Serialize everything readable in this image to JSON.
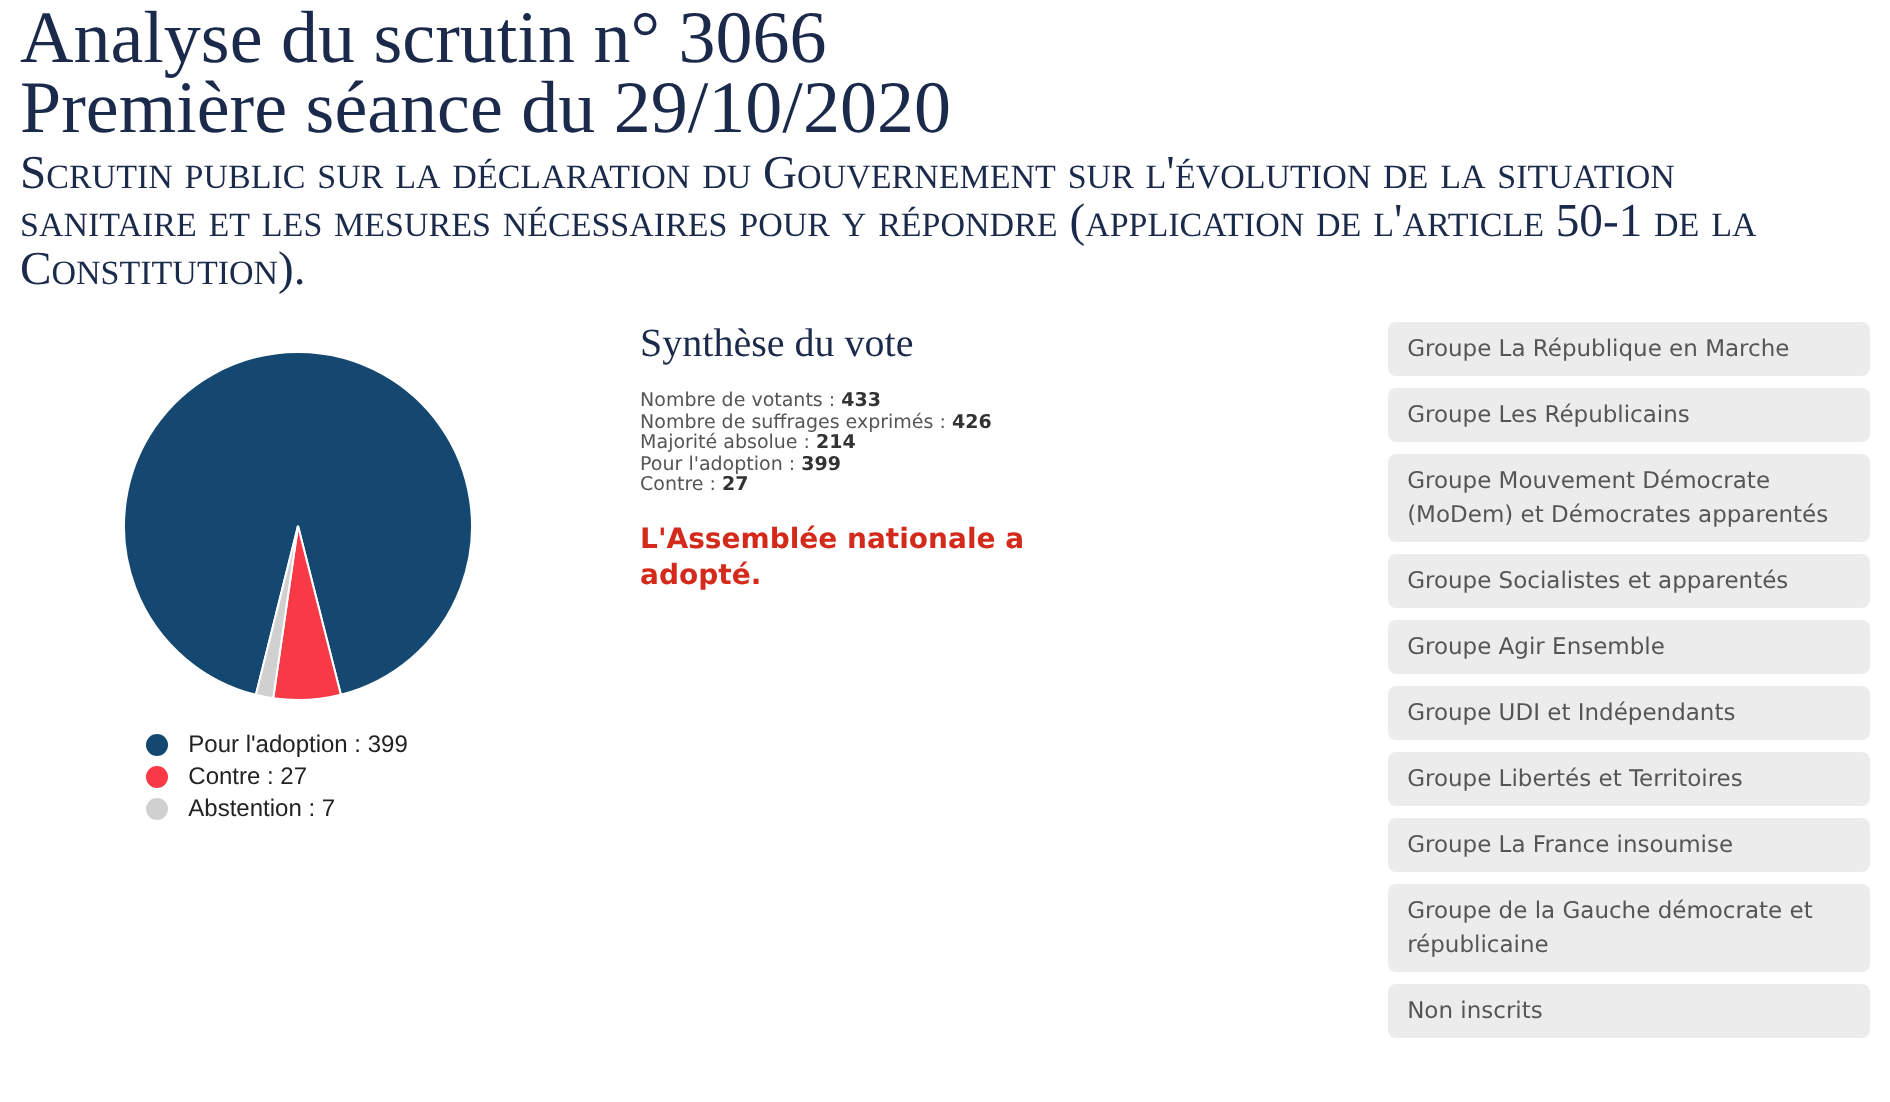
{
  "title": "Analyse du scrutin n° 3066",
  "session": "Première séance du 29/10/2020",
  "subject": "Scrutin public sur la déclaration du Gouvernement sur l'évolution de la situation sanitaire et les mesures nécessaires pour y répondre (application de l'article 50-1 de la Constitution).",
  "chart": {
    "chart_data": {
      "type": "pie",
      "categories": [
        "Pour l'adoption : 399",
        "Contre : 27",
        "Abstention : 7"
      ],
      "values": [
        399,
        27,
        7
      ]
    },
    "legend": [
      {
        "color": "#144870"
      },
      {
        "color": "#f73a46"
      },
      {
        "color": "#d0d0d0"
      }
    ]
  },
  "summary": {
    "heading": "Synthèse du vote",
    "stats": [
      {
        "label": "Nombre de votants :",
        "value": "433"
      },
      {
        "label": "Nombre de suffrages exprimés :",
        "value": "426"
      },
      {
        "label": "Majorité absolue :",
        "value": "214"
      },
      {
        "label": "Pour l'adoption :",
        "value": "399"
      },
      {
        "label": "Contre :",
        "value": "27"
      }
    ],
    "result": "L'Assemblée nationale a adopté."
  },
  "groups": [
    "Groupe La République en Marche",
    "Groupe Les Républicains",
    "Groupe Mouvement Démocrate (MoDem) et Démocrates apparentés",
    "Groupe Socialistes et apparentés",
    "Groupe Agir Ensemble",
    "Groupe UDI et Indépendants",
    "Groupe Libertés et Territoires",
    "Groupe La France insoumise",
    "Groupe de la Gauche démocrate et républicaine",
    "Non inscrits"
  ]
}
